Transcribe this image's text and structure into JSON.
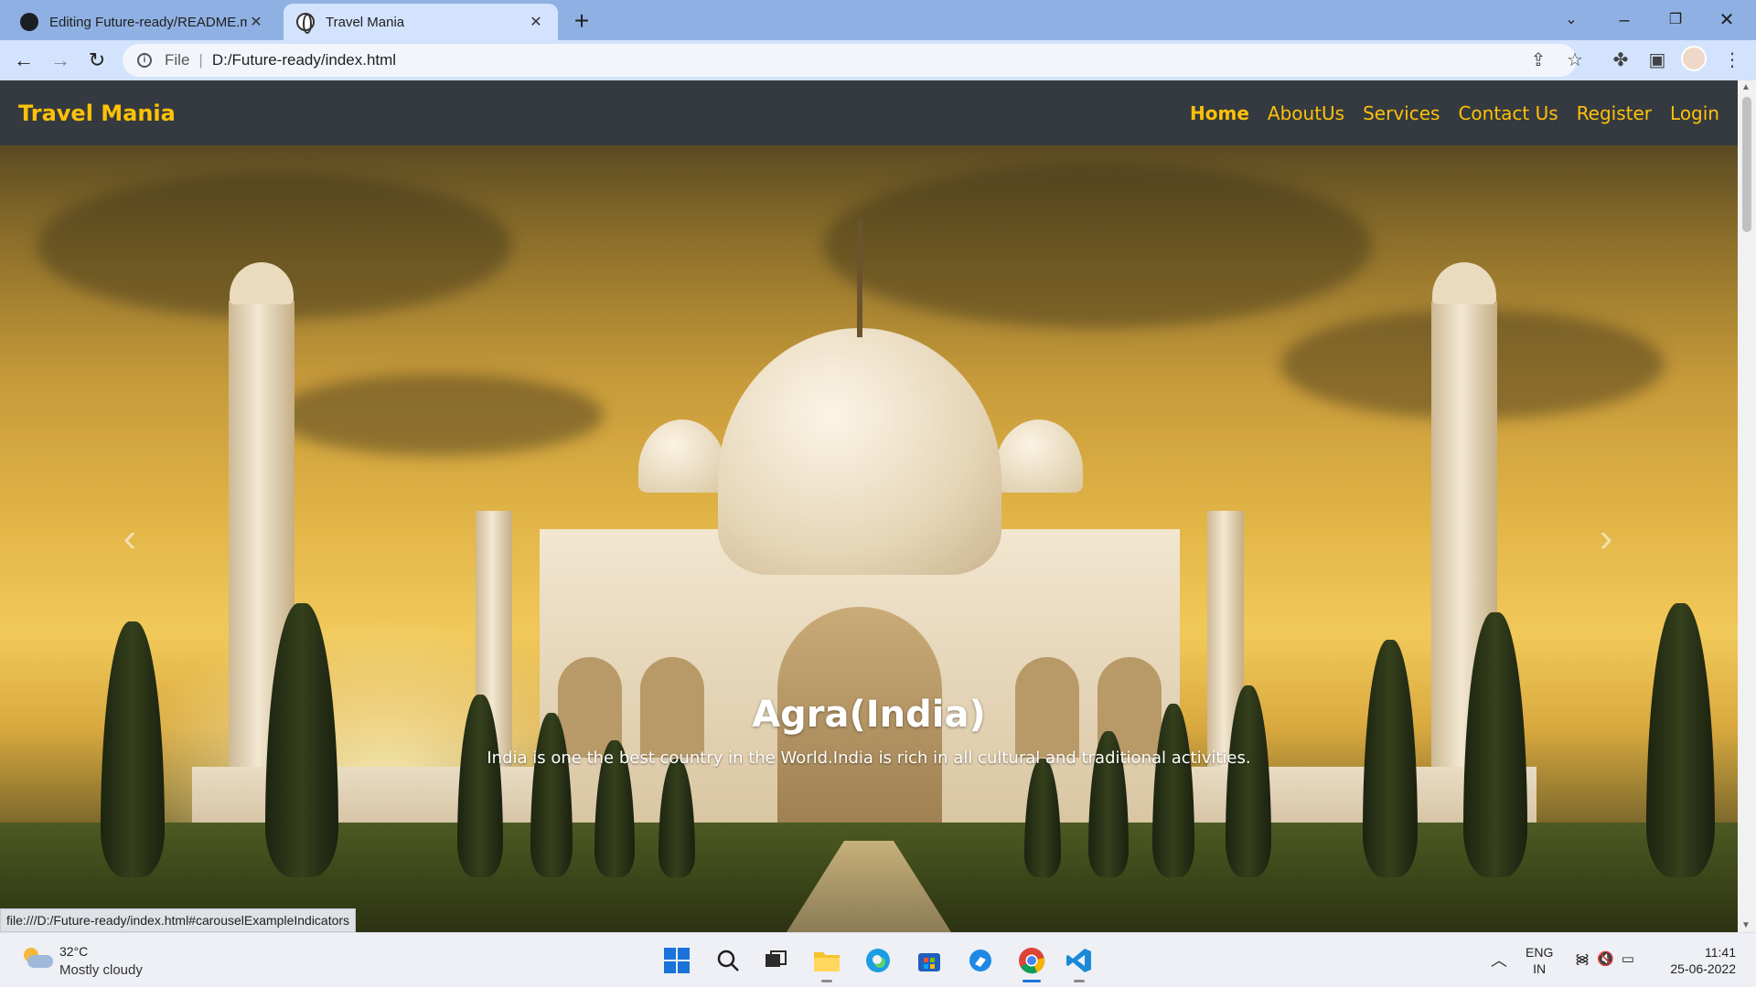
{
  "browser": {
    "tabs": [
      {
        "title": "Editing Future-ready/README.m",
        "icon": "github-icon",
        "active": false
      },
      {
        "title": "Travel Mania",
        "icon": "globe-icon",
        "active": true
      }
    ],
    "address": {
      "scheme": "File",
      "path": "D:/Future-ready/index.html"
    },
    "status_url": "file:///D:/Future-ready/index.html#carouselExampleIndicators"
  },
  "site": {
    "brand": "Travel Mania",
    "nav": [
      "Home",
      "AboutUs",
      "Services",
      "Contact Us",
      "Register",
      "Login"
    ],
    "active_nav": "Home",
    "accent_color": "#ffc107",
    "navbar_color": "#343a40"
  },
  "carousel": {
    "title": "Agra(India)",
    "text": "India is one the best country in the World.India is rich in all cultural and traditional activities.",
    "prev_icon": "chevron-left-icon",
    "next_icon": "chevron-right-icon"
  },
  "taskbar": {
    "weather": {
      "temp": "32°C",
      "desc": "Mostly cloudy"
    },
    "lang": {
      "line1": "ENG",
      "line2": "IN"
    },
    "time": "11:41",
    "date": "25-06-2022",
    "apps": [
      "windows-start-icon",
      "search-icon",
      "task-view-icon",
      "file-explorer-icon",
      "edge-icon",
      "microsoft-store-icon",
      "app-icon",
      "chrome-icon",
      "vscode-icon"
    ]
  }
}
